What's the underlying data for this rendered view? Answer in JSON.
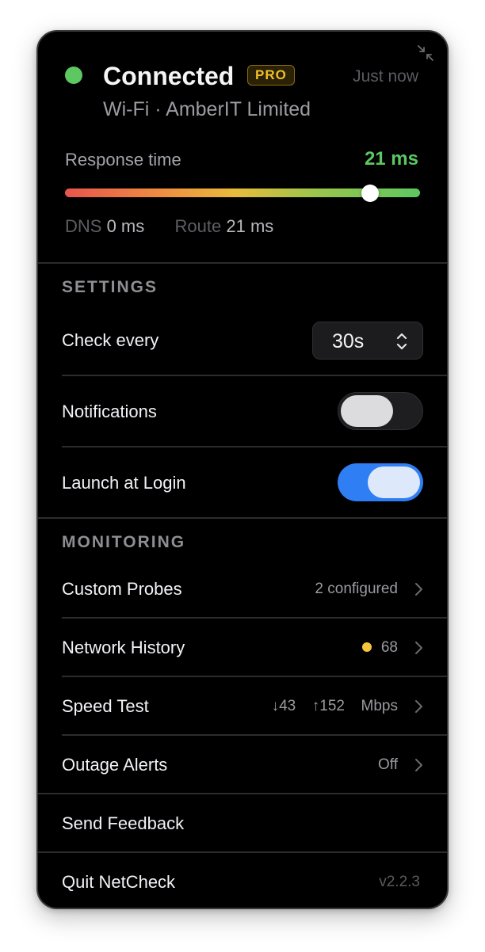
{
  "header": {
    "status": "Connected",
    "badge": "PRO",
    "updated": "Just now",
    "network": "Wi-Fi · AmberIT Limited",
    "response_label": "Response time",
    "response_value": "21 ms",
    "response_level": 0.86,
    "dns_label": "DNS",
    "dns_value": "0 ms",
    "route_label": "Route",
    "route_value": "21 ms"
  },
  "settings": {
    "heading": "SETTINGS",
    "check_every_label": "Check every",
    "check_every_value": "30s",
    "notifications_label": "Notifications",
    "notifications_on": false,
    "launch_label": "Launch at Login",
    "launch_on": true
  },
  "monitoring": {
    "heading": "MONITORING",
    "custom_probes_label": "Custom Probes",
    "custom_probes_value": "2 configured",
    "network_history_label": "Network History",
    "network_history_value": "68",
    "speed_test_label": "Speed Test",
    "speed_down_arrow": "↓",
    "speed_down": "43",
    "speed_up_arrow": "↑",
    "speed_up": "152",
    "speed_unit": "Mbps",
    "outage_alerts_label": "Outage Alerts",
    "outage_alerts_value": "Off"
  },
  "footer": {
    "feedback_label": "Send Feedback",
    "quit_label": "Quit NetCheck",
    "version": "v2.2.3"
  },
  "colors": {
    "status_green": "#5dc761",
    "pro_gold": "#f0bf2b",
    "toggle_blue": "#2f7ef3",
    "history_dot": "#f4c53d"
  },
  "icons": {
    "collapse": "collapse-arrows-icon",
    "stepper": "up-down-chevron-icon",
    "row_chevron": "chevron-right-icon"
  }
}
